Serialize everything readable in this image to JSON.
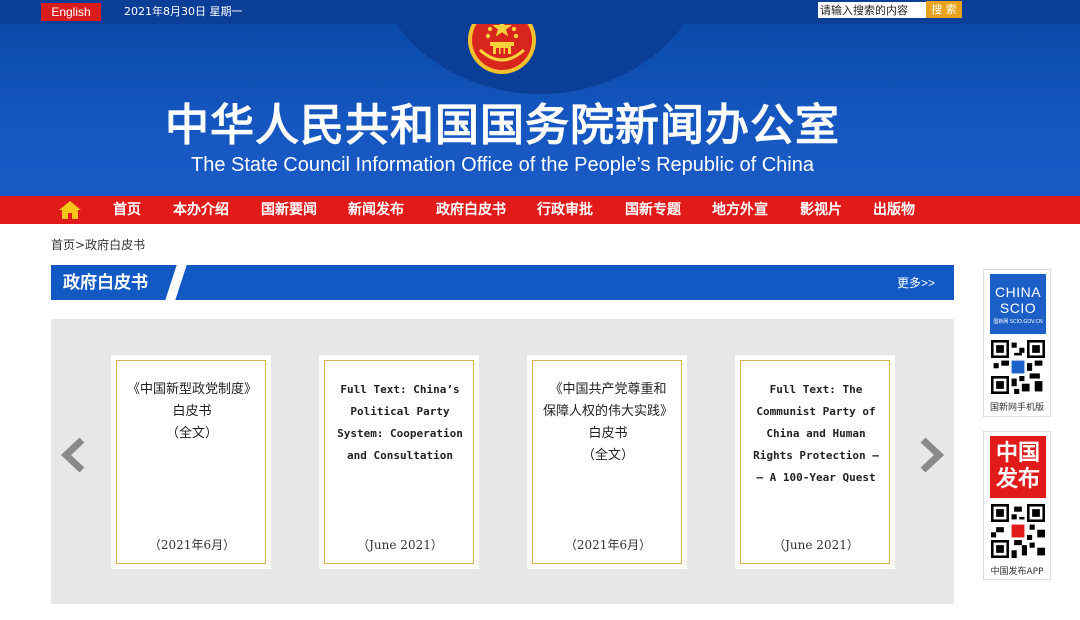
{
  "topbar": {
    "english_label": "English",
    "date": "2021年8月30日 星期一",
    "search_placeholder": "请输入搜索的内容",
    "search_label": "搜 索"
  },
  "banner": {
    "title_cn": "中华人民共和国国务院新闻办公室",
    "title_en": "The State Council Information Office of the People’s Republic of China"
  },
  "nav": {
    "items": [
      "首页",
      "本办介绍",
      "国新要闻",
      "新闻发布",
      "政府白皮书",
      "行政审批",
      "国新专题",
      "地方外宣",
      "影视片",
      "出版物"
    ]
  },
  "breadcrumb": {
    "home": "首页",
    "sep": ">",
    "current": "政府白皮书"
  },
  "section": {
    "title": "政府白皮书",
    "more": "更多>>"
  },
  "cards": [
    {
      "title": "《中国新型政党制度》\n白皮书\n（全文）",
      "date": "（2021年6月）"
    },
    {
      "title": "Full Text: China’s\nPolitical Party\nSystem: Cooperation\nand Consultation",
      "date": "（June 2021）"
    },
    {
      "title": "《中国共产党尊重和\n保障人权的伟大实践》\n白皮书\n（全文）",
      "date": "（2021年6月）"
    },
    {
      "title": "Full Text: The\nCommunist Party of\nChina and Human\nRights Protection —\n— A 100-Year Quest",
      "date": "（June 2021）"
    }
  ],
  "side": {
    "box1_logo_line1": "CHINA",
    "box1_logo_line2": "SCIO",
    "box1_logo_small": "国新网 SCIO.GOV.CN",
    "box1_caption": "国新网手机版",
    "box2_logo_line1": "中国",
    "box2_logo_line2": "发布",
    "box2_caption": "中国发布APP"
  },
  "colors": {
    "banner_blue": "#1556c0",
    "nav_red": "#e11a1a",
    "search_orange": "#e8a31a",
    "card_border_gold": "#d8b24a"
  }
}
